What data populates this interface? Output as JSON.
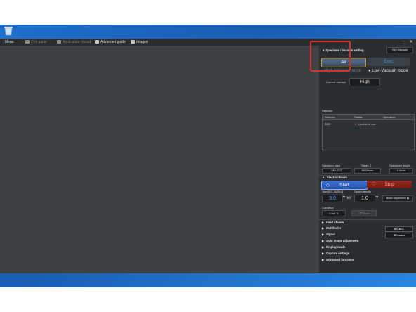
{
  "menubar": {
    "menu": "Menu",
    "ops_guide": "Ops guide",
    "application_wizard": "Application wizard",
    "advanced_guide": "Advanced guide",
    "images": "Images",
    "minimize": "_",
    "close": "✕"
  },
  "vacuum": {
    "header": "Specimen / Vacuum setting",
    "vacuum_mode": "High Vacuum",
    "air_label": "Air",
    "evac_label": "Evac",
    "high_vacuum_mode": "High-Vacuum mode",
    "low_vacuum_mode": "Low-Vacuum mode",
    "current_vacuum_label": "Current vacuum",
    "current_vacuum_value": "High"
  },
  "detector": {
    "header": "Detector",
    "columns": [
      "Detector",
      "Status",
      "Operation"
    ],
    "rows": [
      {
        "detector": "BSE",
        "status": "Unable to use",
        "operation": ""
      }
    ]
  },
  "specimen": {
    "size_label": "Specimen size",
    "size_value": "SELECT",
    "stage_z_label": "Stage Z",
    "stage_z_value": "65.00mm",
    "height_label": "Specimen height",
    "height_value": "0.0mm"
  },
  "electron_beam": {
    "header": "Electron beam",
    "start_label": "Start",
    "stop_label": "Stop",
    "vacc_label": "Vacc[0.5-20.0kV]",
    "vacc_value": "3.0",
    "vacc_unit": "kV",
    "spot_label": "Spot intensity",
    "spot_value": "1.0",
    "beam_adjustment": "Beam adjustment"
  },
  "condition": {
    "header": "Condition",
    "load": "Load",
    "save": "Save"
  },
  "sections": {
    "field_of_view": "Field of view",
    "multifinder": "Multifinder",
    "multifinder_value": "SELECT",
    "signal": "Signal",
    "signal_value": "SE-Lower",
    "auto_image": "Auto image adjustment",
    "display_mode": "Display mode",
    "capture_settings": "Capture settings",
    "advanced_functions": "Advanced functions"
  },
  "colors": {
    "panel_bg": "#2b2e31",
    "viewer_bg": "#3f4244",
    "start_blue": "#2552a8",
    "stop_red": "#9a2a20",
    "highlight": "#d9322b",
    "desktop_blue": "#1e6fcc"
  }
}
